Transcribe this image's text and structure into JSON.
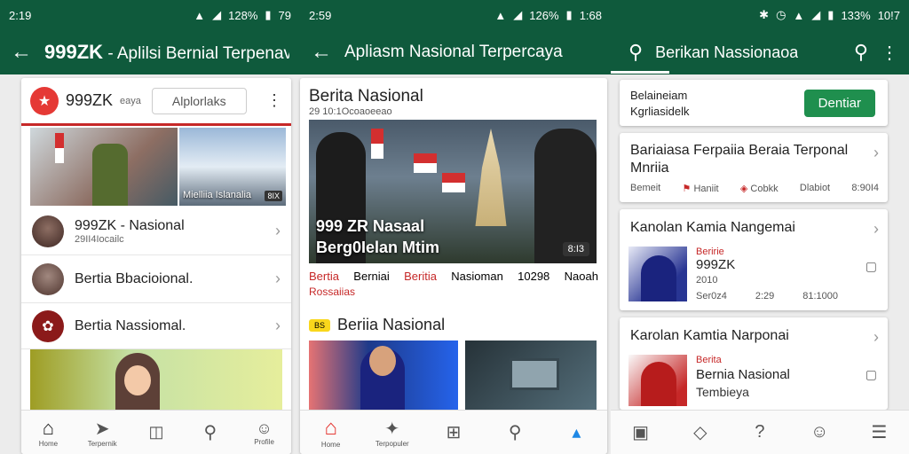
{
  "panel1": {
    "status": {
      "time": "2:19",
      "battery": "128%",
      "extra": "79"
    },
    "appbar_title": "999ZK",
    "appbar_subtitle": "- Aplilsi Bernial Terpenava",
    "header": {
      "brand": "999ZK",
      "brand_sub": "eaya",
      "tab_label": "Alplorlaks"
    },
    "hero_caption": "Mielliia Islanalia",
    "hero_badge": "8IX",
    "list": [
      {
        "title": "999ZK - Nasional",
        "subtitle": "29II4Iocailc"
      },
      {
        "title": "Bertia Bbacioional."
      },
      {
        "title": "Bertia Nassiomal."
      }
    ],
    "nav": [
      "Home",
      "Terpernik",
      "",
      "",
      "Profile"
    ]
  },
  "panel2": {
    "status": {
      "time": "2:59",
      "battery": "126%",
      "extra": "1:68"
    },
    "appbar_title": "Apliasm Nasional Terpercaya",
    "section_title": "Berita Nasional",
    "section_date": "29 10:1Ocoaoeeao",
    "hero_title_1": "999 ZR Nasaal",
    "hero_title_2": "Berg0Ielan Mtim",
    "hero_badge": "8:I3",
    "meta": [
      "Bertia",
      "Berniai",
      "Beritia",
      "Nasioman",
      "10298",
      "Naoah"
    ],
    "meta_sub": "Rossaiias",
    "second_badge": "BS",
    "second_title": "Beriia Nasional",
    "nav_labels": [
      "Home",
      "Terpopuler",
      "",
      "",
      ""
    ]
  },
  "panel3": {
    "status": {
      "battery": "133%",
      "time": "10!7"
    },
    "appbar_title": "Berikan Nassionaoa",
    "top_card": {
      "line1": "Belaineiam",
      "line2": "Kgrliasidelk",
      "button": "Dentiar"
    },
    "article1": {
      "title": "Bariaiasa Ferpaiia Beraia Terponal Mnriia",
      "meta": [
        "Bemeit",
        "Haniit",
        "Cobkk",
        "Dlabiot",
        "8:90I4"
      ]
    },
    "article2": {
      "title": "Kanolan Kamia Nangemai",
      "tag": "Beririe",
      "brand": "999ZK",
      "num": "2010",
      "meta": [
        "Ser0z4",
        "2:29",
        "81:1000"
      ]
    },
    "article3": {
      "title": "Karolan Kamtia Narponai",
      "tag": "Berita",
      "line1": "Bernia Nasional",
      "line2": "Tembieya"
    }
  },
  "colors": {
    "primary": "#0f5a3c",
    "accent": "#c62828",
    "button": "#1f8f4e"
  }
}
